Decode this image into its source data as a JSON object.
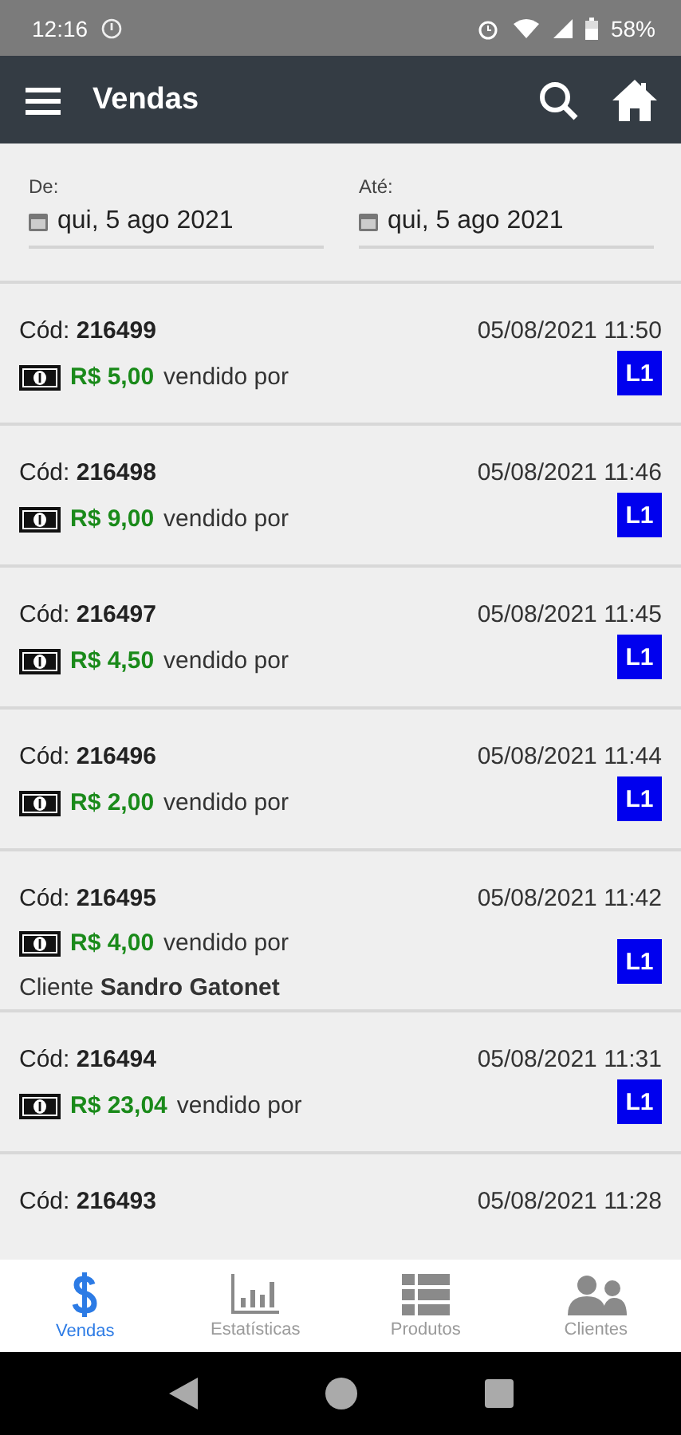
{
  "status_bar": {
    "time": "12:16",
    "battery": "58%"
  },
  "app_bar": {
    "title": "Vendas"
  },
  "filters": [
    {
      "label": "De:",
      "value": "qui, 5 ago 2021"
    },
    {
      "label": "Até:",
      "value": "qui, 5 ago 2021"
    }
  ],
  "sales": [
    {
      "code": "Cód: **216499**",
      "datetime": "05/08/2021 11:50",
      "amount": "R$ 5,00",
      "sold_by": "vendido por",
      "badge": "L1"
    },
    {
      "code": "Cód: **216498**",
      "datetime": "05/08/2021 11:46",
      "amount": "R$ 9,00",
      "sold_by": "vendido por",
      "badge": "L1"
    },
    {
      "code": "Cód: **216497**",
      "datetime": "05/08/2021 11:45",
      "amount": "R$ 4,50",
      "sold_by": "vendido por",
      "badge": "L1"
    },
    {
      "code": "Cód: **216496**",
      "datetime": "05/08/2021 11:44",
      "amount": "R$ 2,00",
      "sold_by": "vendido por",
      "badge": "L1"
    },
    {
      "code": "Cód: **216495**",
      "datetime": "05/08/2021 11:42",
      "amount": "R$ 4,00",
      "sold_by": "vendido por",
      "client": "Cliente **Sandro Gatonet**",
      "badge": "L1"
    },
    {
      "code": "Cód: **216494**",
      "datetime": "05/08/2021 11:31",
      "amount": "R$ 23,04",
      "sold_by": "vendido por",
      "badge": "L1"
    },
    {
      "code": "Cód: **216493**",
      "datetime": "05/08/2021 11:28"
    }
  ],
  "tabs": [
    {
      "label": "Vendas",
      "kind": "dollar",
      "selected": true
    },
    {
      "label": "Estatísticas",
      "kind": "chart",
      "selected": false
    },
    {
      "label": "Produtos",
      "kind": "list",
      "selected": false
    },
    {
      "label": "Clientes",
      "kind": "people",
      "selected": false
    }
  ]
}
